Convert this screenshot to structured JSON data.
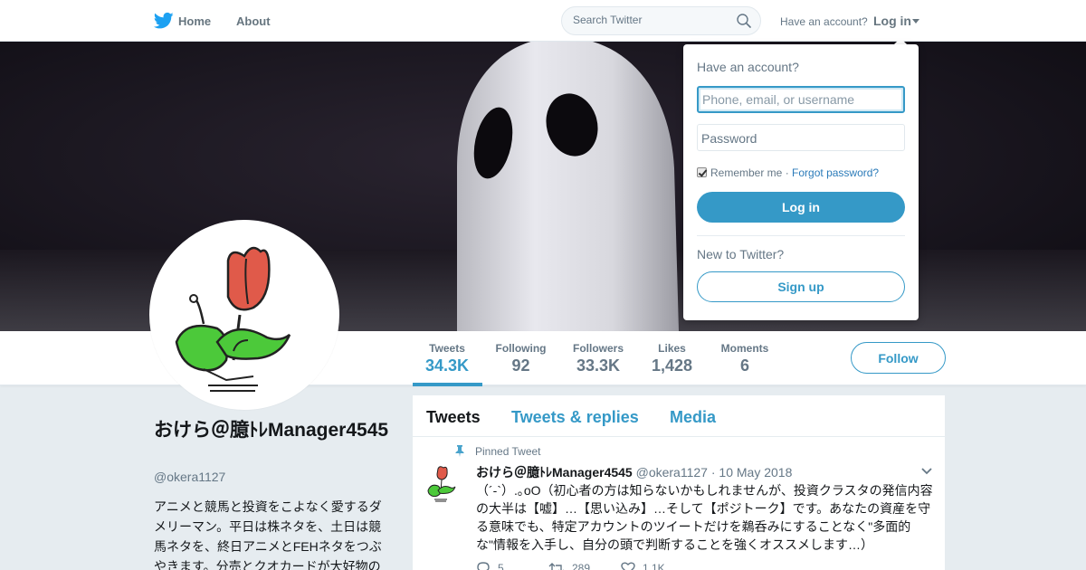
{
  "topbar": {
    "logo_icon": "twitter-bird-icon",
    "home_label": "Home",
    "about_label": "About",
    "search_placeholder": "Search Twitter",
    "have_account": "Have an account?",
    "login_label": "Log in"
  },
  "banner": {
    "image": "ghost-figure-photo"
  },
  "profile": {
    "name": "おけら＠臆ﾄﾚManager4545",
    "handle": "@okera1127",
    "bio": "アニメと競馬と投資をこよなく愛するダメリーマン。平日は株ネタを、土日は競馬ネタを、終日アニメとFEHネタをつぶやきます。分売とクオカードが大好物の",
    "avatar": "tulip-character-avatar"
  },
  "stats": [
    {
      "label": "Tweets",
      "value": "34.3K",
      "active": true
    },
    {
      "label": "Following",
      "value": "92"
    },
    {
      "label": "Followers",
      "value": "33.3K"
    },
    {
      "label": "Likes",
      "value": "1,428"
    },
    {
      "label": "Moments",
      "value": "6"
    }
  ],
  "follow_label": "Follow",
  "timeline": {
    "tabs": [
      "Tweets",
      "Tweets & replies",
      "Media"
    ],
    "tweet": {
      "pinned_label": "Pinned Tweet",
      "name": "おけら＠臆ﾄﾚManager4545",
      "handle": "@okera1127",
      "dot": "·",
      "date": "10 May 2018",
      "text": "（´-`）.｡oO（初心者の方は知らないかもしれませんが、投資クラスタの発信内容の大半は【嘘】…【思い込み】…そして【ポジトーク】です。あなたの資産を守る意味でも、特定アカウントのツイートだけを鵜呑みにすることなく\"多面的な\"情報を入手し、自分の頭で判断することを強くオススメします…）",
      "replies": "5",
      "retweets": "289",
      "likes": "1.1K"
    }
  },
  "login_dropdown": {
    "title": "Have an account?",
    "username_placeholder": "Phone, email, or username",
    "password_placeholder": "Password",
    "remember_me": "Remember me",
    "separator": "·",
    "forgot": "Forgot password?",
    "login_button": "Log in",
    "new_to_twitter": "New to Twitter?",
    "signup_button": "Sign up"
  },
  "colors": {
    "accent": "#3599c7",
    "text": "#14171a",
    "muted": "#657786",
    "background": "#e6ecf0"
  }
}
